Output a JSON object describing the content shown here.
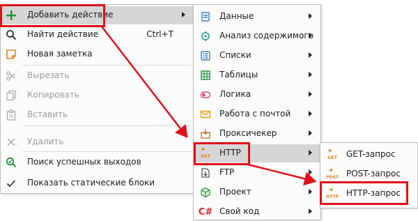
{
  "main_menu": {
    "items": [
      {
        "label": "Добавить действие",
        "icon": "plus-icon",
        "submenu": true,
        "highlighted": true
      },
      {
        "label": "Найти действие",
        "shortcut": "Ctrl+T",
        "icon": "search-icon"
      },
      {
        "label": "Новая заметка",
        "icon": "note-icon"
      },
      {
        "label": "Вырезать",
        "icon": "scissors-icon",
        "disabled": true
      },
      {
        "label": "Копировать",
        "icon": "copy-icon",
        "disabled": true
      },
      {
        "label": "Вставить",
        "icon": "paste-icon",
        "disabled": true
      },
      {
        "label": "Удалить",
        "icon": "delete-icon",
        "disabled": true
      },
      {
        "label": "Поиск успешных выходов",
        "icon": "search-success-icon"
      },
      {
        "label": "Показать статические блоки",
        "icon": "checkmark-icon"
      }
    ]
  },
  "submenu_actions": {
    "items": [
      {
        "label": "Данные",
        "icon": "data-icon"
      },
      {
        "label": "Анализ содержимого",
        "icon": "analysis-icon"
      },
      {
        "label": "Списки",
        "icon": "list-icon"
      },
      {
        "label": "Таблицы",
        "icon": "table-icon"
      },
      {
        "label": "Логика",
        "icon": "logic-icon"
      },
      {
        "label": "Работа с почтой",
        "icon": "mail-icon"
      },
      {
        "label": "Проксичекер",
        "icon": "proxy-checker-icon"
      },
      {
        "label": "HTTP",
        "icon": "http-get-icon",
        "highlighted": true
      },
      {
        "label": "FTP",
        "icon": "ftp-icon"
      },
      {
        "label": "Проект",
        "icon": "project-icon"
      },
      {
        "label": "Свой код",
        "icon": "csharp-icon",
        "icon_text": "C#"
      }
    ]
  },
  "submenu_http": {
    "items": [
      {
        "label": "GET-запрос",
        "icon": "get-request-icon",
        "icon_text": "GET"
      },
      {
        "label": "POST-запрос",
        "icon": "post-request-icon",
        "icon_text": "POST"
      },
      {
        "label": "HTTP-запрос",
        "icon": "http-request-icon",
        "icon_text": "HTTP",
        "highlighted": true
      }
    ]
  },
  "colors": {
    "highlight_border": "#e0101a",
    "hover_background": "#d6d6d6",
    "accent_green": "#1f8f3a",
    "accent_orange": "#e8811a"
  }
}
